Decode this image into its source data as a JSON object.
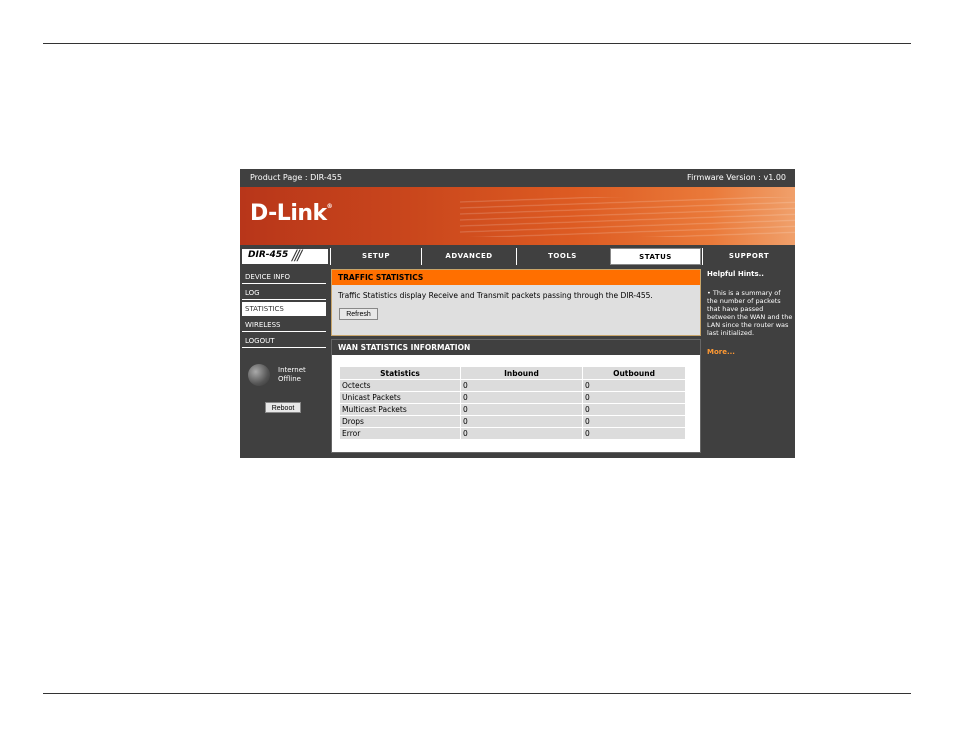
{
  "topbar": {
    "product": "Product Page : DIR-455",
    "firmware": "Firmware Version : v1.00"
  },
  "brand": {
    "logo": "D-Link",
    "registered": "®"
  },
  "model": "DIR-455",
  "tabs": [
    {
      "label": "SETUP"
    },
    {
      "label": "ADVANCED"
    },
    {
      "label": "TOOLS"
    },
    {
      "label": "STATUS"
    },
    {
      "label": "SUPPORT"
    }
  ],
  "sidebar": {
    "items": [
      {
        "label": "DEVICE INFO"
      },
      {
        "label": "LOG"
      },
      {
        "label": "STATISTICS"
      },
      {
        "label": "WIRELESS"
      },
      {
        "label": "LOGOUT"
      }
    ],
    "internet_line1": "Internet",
    "internet_line2": "Offline",
    "reboot_label": "Reboot"
  },
  "traffic": {
    "title": "TRAFFIC STATISTICS",
    "description": "Traffic Statistics display Receive and Transmit packets passing through the DIR-455.",
    "refresh_label": "Refresh"
  },
  "wan": {
    "title": "WAN STATISTICS INFORMATION",
    "headers": [
      "Statistics",
      "Inbound",
      "Outbound"
    ],
    "rows": [
      [
        "Octects",
        "0",
        "0"
      ],
      [
        "Unicast Packets",
        "0",
        "0"
      ],
      [
        "Multicast Packets",
        "0",
        "0"
      ],
      [
        "Drops",
        "0",
        "0"
      ],
      [
        "Error",
        "0",
        "0"
      ]
    ]
  },
  "hints": {
    "title": "Helpful Hints..",
    "text": "• This is a summary of the number of packets that have passed between the WAN and the LAN since the router was last initialized.",
    "more": "More..."
  }
}
